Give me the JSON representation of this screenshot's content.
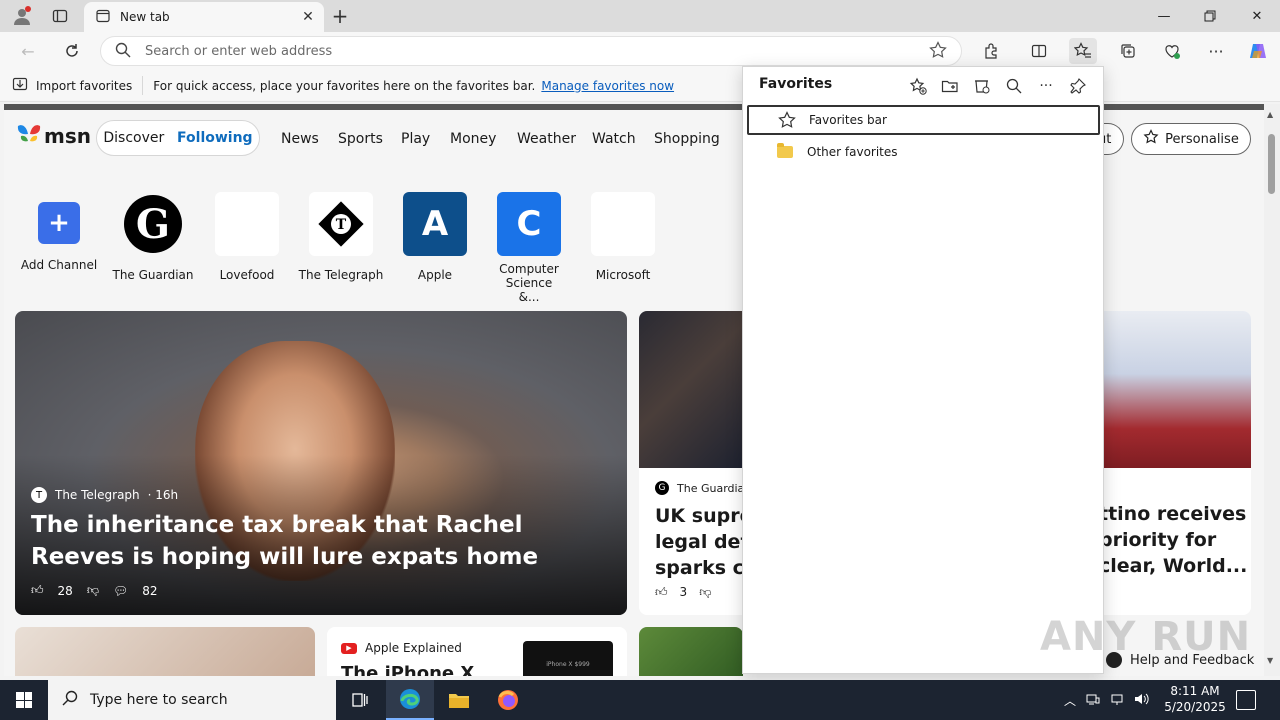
{
  "browser": {
    "tab_title": "New tab",
    "address_placeholder": "Search or enter web address"
  },
  "favbar": {
    "import_label": "Import favorites",
    "hint": "For quick access, place your favorites here on the favorites bar.",
    "manage_link": "Manage favorites now"
  },
  "msn": {
    "logo": "msn",
    "segments": [
      "Discover",
      "Following"
    ],
    "nav": [
      "News",
      "Sports",
      "Play",
      "Money",
      "Weather",
      "Watch",
      "Shopping"
    ],
    "partial_button": "ut",
    "personalise": "Personalise",
    "channels": [
      {
        "label": "Add Channel",
        "glyph": "+",
        "bg": "#3a6ee8",
        "fg": "#ffffff"
      },
      {
        "label": "The Guardian",
        "glyph": "G",
        "bg": "#ffffff",
        "fg": "#000000"
      },
      {
        "label": "Lovefood",
        "glyph": "",
        "bg": "#ffffff",
        "fg": "#000000"
      },
      {
        "label": "The Telegraph",
        "glyph": "T",
        "bg": "#ffffff",
        "fg": "#000000"
      },
      {
        "label": "Apple",
        "glyph": "A",
        "bg": "#0d4f8b",
        "fg": "#ffffff"
      },
      {
        "label": "Computer Science &...",
        "glyph": "C",
        "bg": "#1a73e8",
        "fg": "#ffffff"
      },
      {
        "label": "Microsoft",
        "glyph": "",
        "bg": "#ffffff",
        "fg": "#000000"
      }
    ],
    "hero": {
      "source": "The Telegraph",
      "age": "· 16h",
      "headline": "The inheritance tax break that Rachel Reeves is hoping will lure expats home",
      "likes": "28",
      "comments": "82"
    },
    "card2": {
      "source": "The Guardia",
      "headline_lines": [
        "UK supren",
        "legal defir",
        "sparks cel"
      ],
      "likes": "3"
    },
    "card3": {
      "headline_lines": [
        "ttino receives",
        "priority for",
        "clear, World..."
      ]
    },
    "bottom2": {
      "source": "Apple Explained",
      "headline": "The iPhone X",
      "thumb_text": "iPhone X $999"
    },
    "help": "Help and Feedback"
  },
  "favorites_panel": {
    "title": "Favorites",
    "items": [
      {
        "label": "Favorites bar",
        "icon": "star-icon"
      },
      {
        "label": "Other favorites",
        "icon": "folder-icon"
      }
    ]
  },
  "watermark": "ANY RUN",
  "taskbar": {
    "search_placeholder": "Type here to search",
    "time": "8:11 AM",
    "date": "5/20/2025"
  },
  "colors": {
    "accent": "#0f6cbd",
    "taskbar_bg": "#1c2431"
  }
}
